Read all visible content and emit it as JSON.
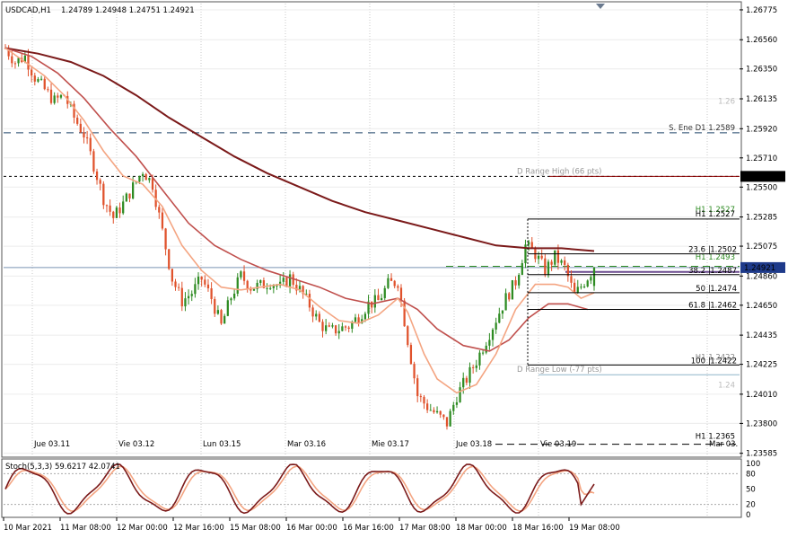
{
  "header": {
    "symbol_text": "USDCAD,H1",
    "ohlc_text": "1.24789 1.24948 1.24751 1.24921"
  },
  "stoch_header": "Stoch(5,3,3) 59.6217 42.0741",
  "colors": {
    "bull": "#2e8b22",
    "bear": "#e0522c",
    "ma_fast": "#f4a582",
    "ma_mid": "#c0504d",
    "ma_slow": "#7b1a1a",
    "price_tag_bg": "#1e3a8a",
    "range_high_line": "#8b0000",
    "fib": "#000000",
    "stoch_main": "#7b1a1a",
    "stoch_signal": "#f4a582"
  },
  "price_axis": {
    "labels": [
      "1.26775",
      "1.26560",
      "1.26350",
      "1.26135",
      "1.25920",
      "1.25710",
      "1.25500",
      "1.25285",
      "1.25075",
      "1.24860",
      "1.24650",
      "1.24435",
      "1.24225",
      "1.24010",
      "1.23800",
      "1.23585"
    ],
    "current_price": "1.24921",
    "range_high_price": "1.25577"
  },
  "stoch_axis": {
    "labels": [
      "100",
      "80",
      "50",
      "20",
      "0"
    ]
  },
  "time_axis": {
    "labels": [
      "10 Mar 2021",
      "11 Mar 08:00",
      "12 Mar 00:00",
      "12 Mar 16:00",
      "15 Mar 08:00",
      "16 Mar 00:00",
      "16 Mar 16:00",
      "17 Mar 08:00",
      "18 Mar 00:00",
      "18 Mar 16:00",
      "19 Mar 08:00"
    ]
  },
  "day_labels": [
    "Jue 03.11",
    "Vie 03.12",
    "Lun 03.15",
    "Mar 03.16",
    "Mie 03.17",
    "Jue 03.18",
    "Vie 03.19",
    "Mar 03."
  ],
  "levels": {
    "s_ene_d1": "S. Ene D1 1.2589",
    "level_126": "1.26",
    "d_range_high": "D Range High (66 pts)",
    "h1_top_a": "H1 1.2527",
    "h1_top_b": "H1 1.2527",
    "h1_mid": "H1 1.2493",
    "d_range_low": "D Range Low (-77 pts)",
    "level_124": "1.24",
    "h1_low_a": "H1 1.2422",
    "h1_bottom": "H1 1.2365"
  },
  "fib_levels": [
    {
      "pct": "23.6",
      "price": "1.2502"
    },
    {
      "pct": "38.2",
      "price": "1.2487"
    },
    {
      "pct": "50",
      "price": "1.2474"
    },
    {
      "pct": "61.8",
      "price": "1.2462"
    },
    {
      "pct": "100",
      "price": "1.2422"
    }
  ],
  "chart_data": {
    "type": "candlestick",
    "title": "USDCAD,H1",
    "ylim": [
      1.2357,
      1.2682
    ],
    "grid": true,
    "ohlc_last": {
      "open": 1.24789,
      "high": 1.24948,
      "low": 1.24751,
      "close": 1.24921
    },
    "close_path": [
      [
        0,
        1.265
      ],
      [
        3,
        1.264
      ],
      [
        6,
        1.2644
      ],
      [
        9,
        1.2629
      ],
      [
        12,
        1.262
      ],
      [
        15,
        1.2612
      ],
      [
        18,
        1.2616
      ],
      [
        21,
        1.26
      ],
      [
        24,
        1.2588
      ],
      [
        27,
        1.2566
      ],
      [
        30,
        1.2542
      ],
      [
        33,
        1.2528
      ],
      [
        36,
        1.2538
      ],
      [
        39,
        1.255
      ],
      [
        42,
        1.2562
      ],
      [
        45,
        1.2552
      ],
      [
        48,
        1.2518
      ],
      [
        51,
        1.2484
      ],
      [
        54,
        1.2468
      ],
      [
        57,
        1.2474
      ],
      [
        60,
        1.2484
      ],
      [
        63,
        1.247
      ],
      [
        66,
        1.245
      ],
      [
        69,
        1.2471
      ],
      [
        72,
        1.2486
      ],
      [
        75,
        1.2478
      ],
      [
        78,
        1.2479
      ],
      [
        81,
        1.2482
      ],
      [
        84,
        1.2478
      ],
      [
        87,
        1.2485
      ],
      [
        90,
        1.2476
      ],
      [
        93,
        1.2465
      ],
      [
        96,
        1.2452
      ],
      [
        99,
        1.2446
      ],
      [
        102,
        1.2448
      ],
      [
        105,
        1.245
      ],
      [
        108,
        1.2457
      ],
      [
        111,
        1.2466
      ],
      [
        114,
        1.2468
      ],
      [
        117,
        1.248
      ],
      [
        120,
        1.2482
      ],
      [
        123,
        1.244
      ],
      [
        126,
        1.24
      ],
      [
        129,
        1.2392
      ],
      [
        132,
        1.2386
      ],
      [
        135,
        1.238
      ],
      [
        138,
        1.24
      ],
      [
        141,
        1.2412
      ],
      [
        144,
        1.2425
      ],
      [
        147,
        1.244
      ],
      [
        150,
        1.2455
      ],
      [
        153,
        1.247
      ],
      [
        156,
        1.2482
      ],
      [
        159,
        1.2508
      ],
      [
        162,
        1.2502
      ],
      [
        165,
        1.249
      ],
      [
        168,
        1.25
      ],
      [
        171,
        1.2492
      ],
      [
        174,
        1.2472
      ],
      [
        177,
        1.2482
      ],
      [
        180,
        1.2492
      ]
    ],
    "ma_fast": [
      [
        0,
        1.265
      ],
      [
        6,
        1.264
      ],
      [
        12,
        1.263
      ],
      [
        18,
        1.2616
      ],
      [
        24,
        1.2598
      ],
      [
        30,
        1.2576
      ],
      [
        36,
        1.2558
      ],
      [
        42,
        1.2552
      ],
      [
        48,
        1.2536
      ],
      [
        54,
        1.2508
      ],
      [
        60,
        1.249
      ],
      [
        66,
        1.2478
      ],
      [
        72,
        1.2476
      ],
      [
        78,
        1.2478
      ],
      [
        84,
        1.248
      ],
      [
        90,
        1.2476
      ],
      [
        96,
        1.2464
      ],
      [
        102,
        1.2454
      ],
      [
        108,
        1.2452
      ],
      [
        114,
        1.2458
      ],
      [
        120,
        1.247
      ],
      [
        123,
        1.246
      ],
      [
        128,
        1.243
      ],
      [
        132,
        1.2412
      ],
      [
        138,
        1.2402
      ],
      [
        144,
        1.2408
      ],
      [
        150,
        1.243
      ],
      [
        156,
        1.2462
      ],
      [
        162,
        1.248
      ],
      [
        168,
        1.248
      ],
      [
        172,
        1.2478
      ],
      [
        176,
        1.247
      ],
      [
        180,
        1.2474
      ]
    ],
    "ma_mid": [
      [
        0,
        1.265
      ],
      [
        8,
        1.2644
      ],
      [
        16,
        1.2632
      ],
      [
        24,
        1.2614
      ],
      [
        32,
        1.2592
      ],
      [
        40,
        1.2572
      ],
      [
        48,
        1.2548
      ],
      [
        56,
        1.2524
      ],
      [
        64,
        1.2508
      ],
      [
        72,
        1.2498
      ],
      [
        80,
        1.249
      ],
      [
        88,
        1.2484
      ],
      [
        96,
        1.2478
      ],
      [
        104,
        1.247
      ],
      [
        112,
        1.2466
      ],
      [
        120,
        1.247
      ],
      [
        126,
        1.2462
      ],
      [
        132,
        1.2448
      ],
      [
        140,
        1.2436
      ],
      [
        148,
        1.2432
      ],
      [
        154,
        1.244
      ],
      [
        160,
        1.2456
      ],
      [
        166,
        1.2466
      ],
      [
        172,
        1.2466
      ],
      [
        178,
        1.2462
      ]
    ],
    "ma_slow": [
      [
        0,
        1.265
      ],
      [
        10,
        1.2646
      ],
      [
        20,
        1.264
      ],
      [
        30,
        1.263
      ],
      [
        40,
        1.2616
      ],
      [
        50,
        1.26
      ],
      [
        60,
        1.2586
      ],
      [
        70,
        1.2572
      ],
      [
        80,
        1.256
      ],
      [
        90,
        1.255
      ],
      [
        100,
        1.254
      ],
      [
        110,
        1.2532
      ],
      [
        120,
        1.2526
      ],
      [
        130,
        1.252
      ],
      [
        140,
        1.2514
      ],
      [
        150,
        1.2508
      ],
      [
        160,
        1.2506
      ],
      [
        170,
        1.2506
      ],
      [
        180,
        1.2504
      ]
    ],
    "stoch": {
      "k": 59.6217,
      "d": 42.0741,
      "ylim": [
        0,
        100
      ]
    }
  }
}
